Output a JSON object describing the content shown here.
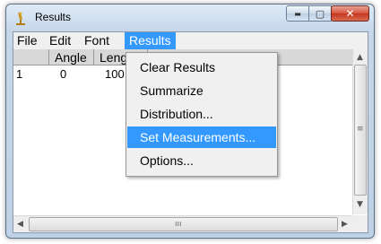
{
  "window": {
    "title": "Results",
    "minimize_glyph": "▬",
    "maximize_glyph": "▢",
    "close_glyph": "✕",
    "app_icon": "microscope-icon"
  },
  "menubar": {
    "items": [
      "File",
      "Edit",
      "Font",
      "Results"
    ],
    "active": "Results"
  },
  "table": {
    "headers": [
      "",
      "Angle",
      "Leng"
    ],
    "rows": [
      [
        "1",
        "0",
        "100"
      ]
    ]
  },
  "dropdown": {
    "items": [
      "Clear Results",
      "Summarize",
      "Distribution...",
      "Set Measurements...",
      "Options..."
    ],
    "highlighted": "Set Measurements..."
  },
  "scrollbars": {
    "up_glyph": "▲",
    "down_glyph": "▼",
    "left_glyph": "◀",
    "right_glyph": "▶",
    "v_grip": "≡",
    "h_grip": "ııı"
  },
  "colors": {
    "accent": "#3399ff",
    "close_button": "#c4371f"
  }
}
